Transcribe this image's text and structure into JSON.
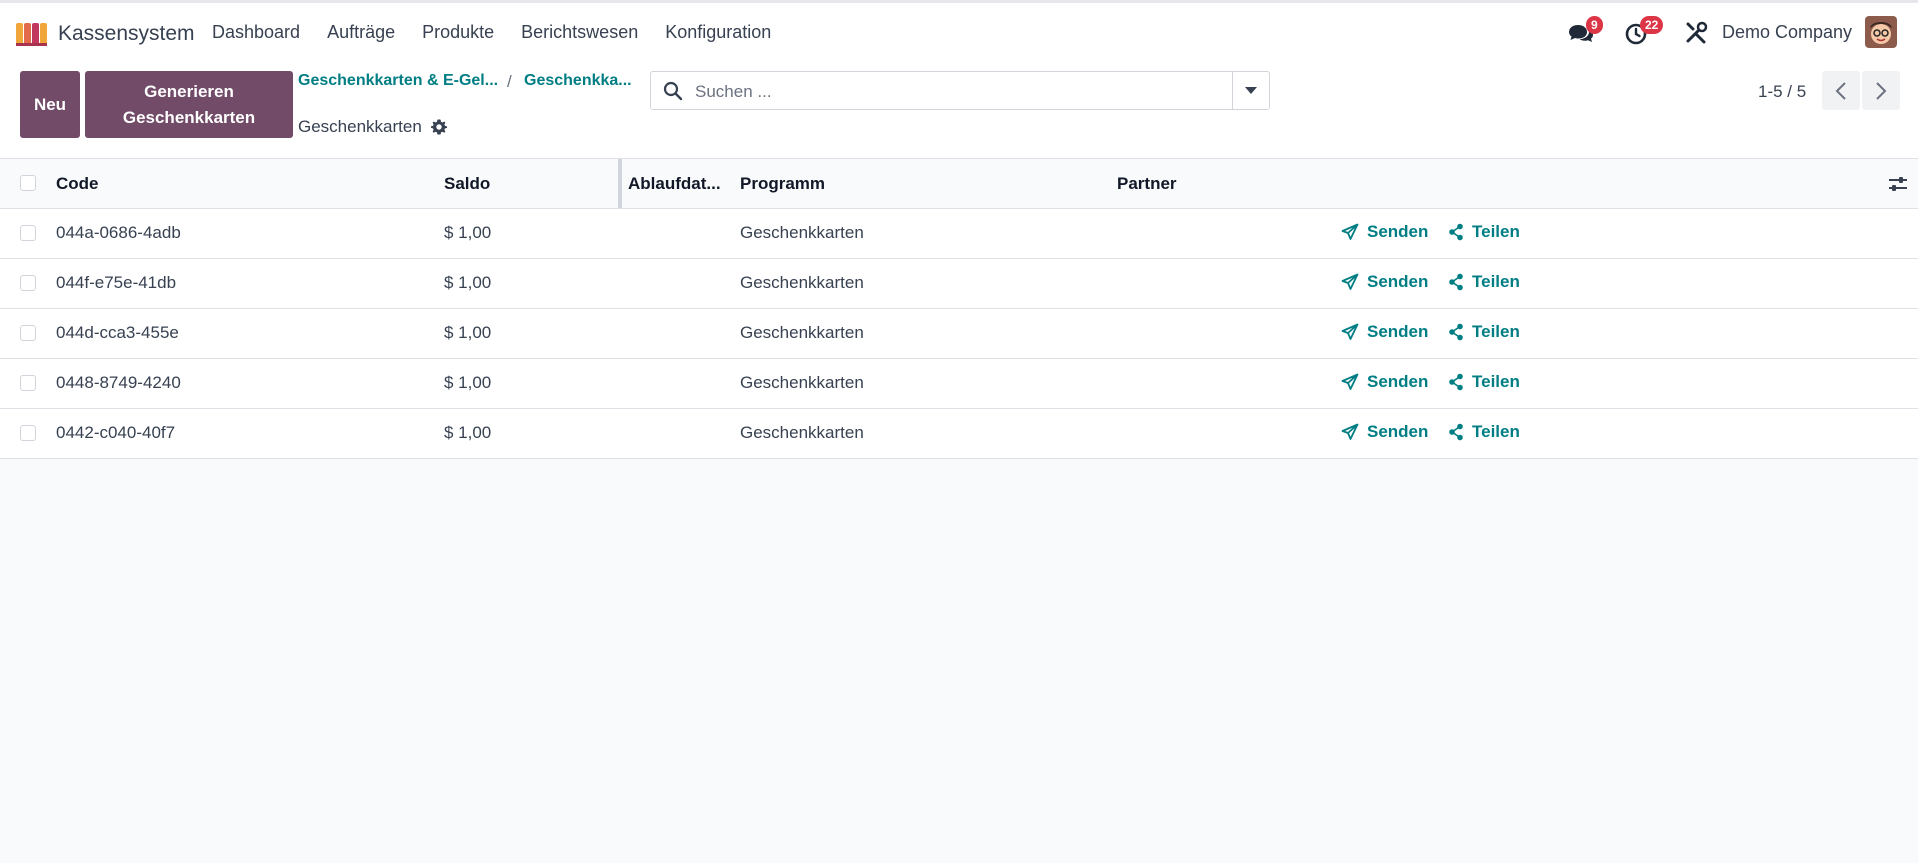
{
  "app": {
    "name": "Kassensystem"
  },
  "nav": {
    "menu": [
      "Dashboard",
      "Aufträge",
      "Produkte",
      "Berichtswesen",
      "Konfiguration"
    ],
    "messages_count": "9",
    "activities_count": "22",
    "company": "Demo Company"
  },
  "control": {
    "new_label": "Neu",
    "generate_line1": "Generieren",
    "generate_line2": "Geschenkkarten",
    "breadcrumb_1": "Geschenkkarten & E-Gel...",
    "breadcrumb_2": "Geschenkka...",
    "breadcrumb_sep": "/",
    "current": "Geschenkkarten",
    "search_placeholder": "Suchen ...",
    "pager": "1-5 / 5"
  },
  "table": {
    "columns": [
      "Code",
      "Saldo",
      "Ablaufdat...",
      "Programm",
      "Partner"
    ],
    "rows": [
      {
        "code": "044a-0686-4adb",
        "saldo": "$ 1,00",
        "programm": "Geschenkkarten",
        "send": "Senden",
        "share": "Teilen"
      },
      {
        "code": "044f-e75e-41db",
        "saldo": "$ 1,00",
        "programm": "Geschenkkarten",
        "send": "Senden",
        "share": "Teilen"
      },
      {
        "code": "044d-cca3-455e",
        "saldo": "$ 1,00",
        "programm": "Geschenkkarten",
        "send": "Senden",
        "share": "Teilen"
      },
      {
        "code": "0448-8749-4240",
        "saldo": "$ 1,00",
        "programm": "Geschenkkarten",
        "send": "Senden",
        "share": "Teilen"
      },
      {
        "code": "0442-c040-40f7",
        "saldo": "$ 1,00",
        "programm": "Geschenkkarten",
        "send": "Senden",
        "share": "Teilen"
      }
    ]
  },
  "colors": {
    "brand": "#714b67",
    "link": "#017e84",
    "badge": "#dc3545"
  },
  "icons": [
    "app-icon",
    "chat-icon",
    "clock-icon",
    "tools-icon",
    "avatar",
    "gear-icon",
    "search-icon",
    "caret-down-icon",
    "chevron-left-icon",
    "chevron-right-icon",
    "paper-plane-icon",
    "share-icon",
    "settings-sliders-icon"
  ]
}
